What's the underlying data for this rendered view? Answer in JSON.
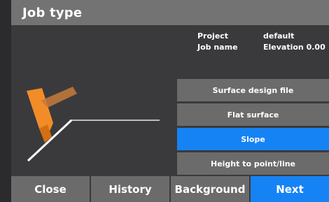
{
  "title": "Job type",
  "info": {
    "labels": [
      "Project",
      "Job name"
    ],
    "values": [
      "default",
      "Elevation 0.00"
    ]
  },
  "options": [
    {
      "label": "Surface design file",
      "selected": false
    },
    {
      "label": "Flat surface",
      "selected": false
    },
    {
      "label": "Slope",
      "selected": true
    },
    {
      "label": "Height to point/line",
      "selected": false
    }
  ],
  "bottom": {
    "close": "Close",
    "history": "History",
    "background": "Background",
    "next": "Next"
  },
  "colors": {
    "accent": "#1683f5",
    "titlebar": "#737373",
    "button": "#6b6b6b",
    "bucket": "#f28c28"
  }
}
